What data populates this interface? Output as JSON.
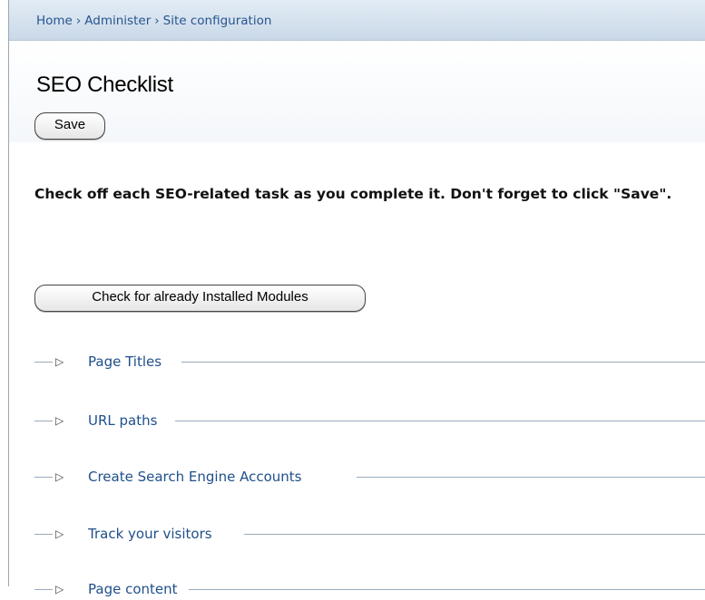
{
  "breadcrumb": {
    "items": [
      "Home",
      "Administer",
      "Site configuration"
    ],
    "separator": "›"
  },
  "page": {
    "title": "SEO Checklist",
    "save_label": "Save",
    "instructions": "Check off each SEO-related task as you complete it. Don't forget to click \"Save\".",
    "modules_button_label": "Check for already Installed Modules"
  },
  "sections": [
    {
      "label": "Page Titles"
    },
    {
      "label": "URL paths"
    },
    {
      "label": "Create Search Engine Accounts"
    },
    {
      "label": "Track your visitors"
    },
    {
      "label": "Page content"
    }
  ],
  "icons": {
    "collapsed": "triangle-right-icon"
  },
  "colors": {
    "link": "#1f4f8a",
    "breadcrumb_bg": "#c9d8e8"
  }
}
